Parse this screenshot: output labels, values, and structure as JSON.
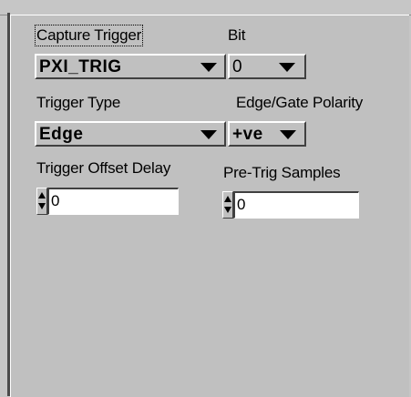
{
  "capture_trigger": {
    "label": "Capture Trigger",
    "value": "PXI_TRIG"
  },
  "bit": {
    "label": "Bit",
    "value": "0"
  },
  "trigger_type": {
    "label": "Trigger Type",
    "value": "Edge"
  },
  "polarity": {
    "label": "Edge/Gate Polarity",
    "value": "+ve"
  },
  "offset_delay": {
    "label": "Trigger Offset Delay",
    "value": "0"
  },
  "pretrig": {
    "label": "Pre-Trig Samples",
    "value": "0"
  }
}
